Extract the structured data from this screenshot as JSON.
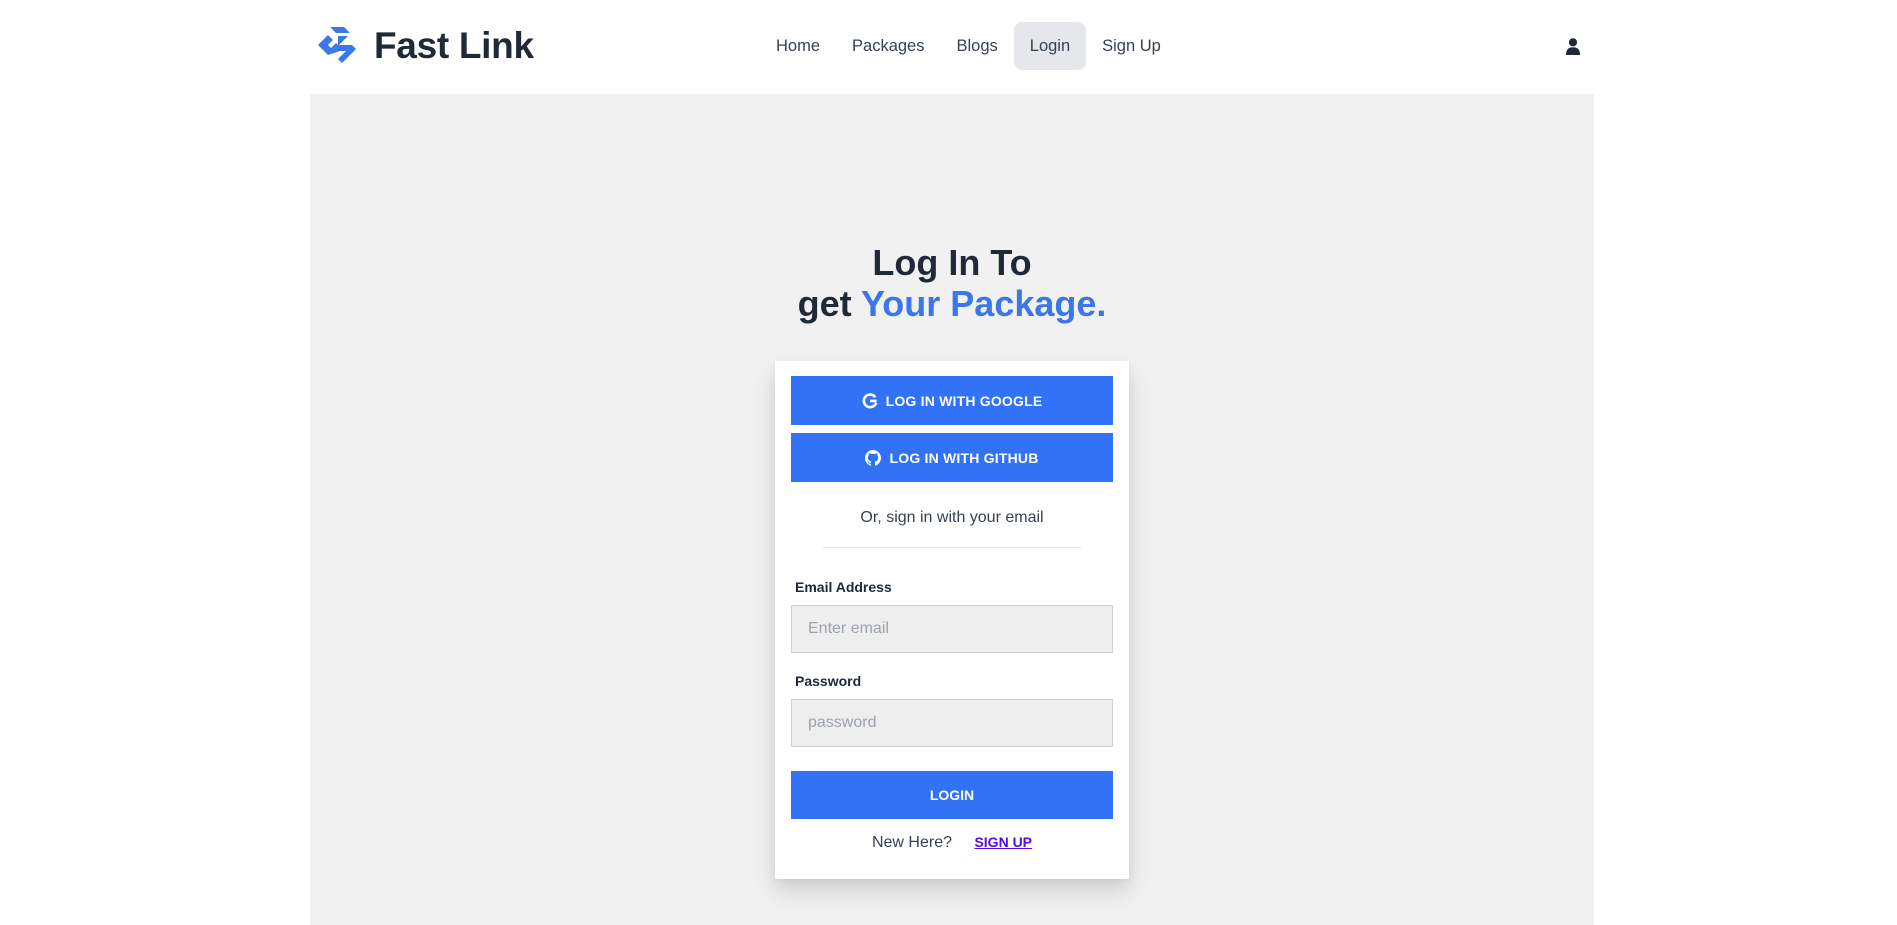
{
  "brand": {
    "name": "Fast Link",
    "logo_icon": "fast-link-logo-icon"
  },
  "nav": {
    "links": [
      {
        "label": "Home",
        "active": false
      },
      {
        "label": "Packages",
        "active": false
      },
      {
        "label": "Blogs",
        "active": false
      },
      {
        "label": "Login",
        "active": true
      },
      {
        "label": "Sign Up",
        "active": false
      }
    ],
    "user_icon": "user-icon"
  },
  "hero": {
    "line1": "Log In To",
    "line2_prefix": "get",
    "line2_accent": "Your Package."
  },
  "login": {
    "google_label": "LOG IN WITH GOOGLE",
    "github_label": "LOG IN WITH GITHUB",
    "or_text": "Or, sign in with your email",
    "email_label": "Email Address",
    "email_placeholder": "Enter email",
    "email_value": "",
    "password_label": "Password",
    "password_placeholder": "password",
    "password_value": "",
    "submit_label": "LOGIN",
    "new_here": "New Here?",
    "signup_link": "SIGN UP"
  },
  "colors": {
    "primary": "#3172f7",
    "accent_text": "#3b76ea",
    "panel_bg": "#f1f1f1",
    "link": "#4f0fe6",
    "active_nav_bg": "#e5e7eb"
  }
}
